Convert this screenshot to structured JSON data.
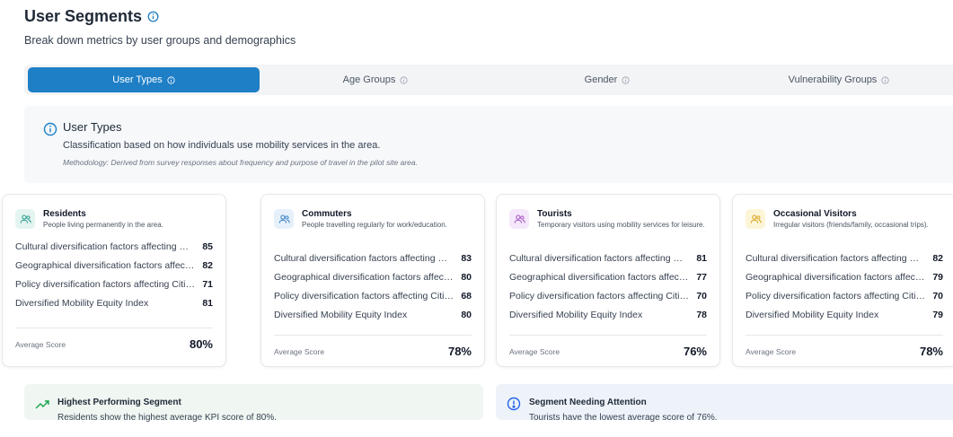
{
  "page": {
    "title": "User Segments",
    "subtitle": "Break down metrics by user groups and demographics"
  },
  "tabs": [
    {
      "label": "User Types",
      "active": true
    },
    {
      "label": "Age Groups",
      "active": false
    },
    {
      "label": "Gender",
      "active": false
    },
    {
      "label": "Vulnerability Groups",
      "active": false
    }
  ],
  "info": {
    "title": "User Types",
    "description": "Classification based on how individuals use mobility services in the area.",
    "methodology": "Methodology: Derived from survey responses about frequency and purpose of travel in the pilot site area."
  },
  "segments": [
    {
      "name": "Residents",
      "description": "People living permanently in the area.",
      "icon": "users-icon",
      "icon_color": "#2e9e8f",
      "icon_bg": "#e3f4f1",
      "metrics": [
        {
          "label": "Cultural diversification factors affecting mobility equity",
          "value": "85"
        },
        {
          "label": "Geographical diversification factors affecting mobility equity",
          "value": "82"
        },
        {
          "label": "Policy diversification factors affecting Cities mobility equity",
          "value": "71"
        },
        {
          "label": "Diversified Mobility Equity Index",
          "value": "81"
        }
      ],
      "average_label": "Average Score",
      "average": "80%"
    },
    {
      "name": "Commuters",
      "description": "People travelling regularly for work/education.",
      "icon": "users-icon",
      "icon_color": "#3b82c4",
      "icon_bg": "#e6f0fa",
      "metrics": [
        {
          "label": "Cultural diversification factors affecting mobility equity",
          "value": "83"
        },
        {
          "label": "Geographical diversification factors affecting mobility equity",
          "value": "80"
        },
        {
          "label": "Policy diversification factors affecting Cities mobility equity",
          "value": "68"
        },
        {
          "label": "Diversified Mobility Equity Index",
          "value": "80"
        }
      ],
      "average_label": "Average Score",
      "average": "78%"
    },
    {
      "name": "Tourists",
      "description": "Temporary visitors using mobility services for leisure.",
      "icon": "users-icon",
      "icon_color": "#a855c7",
      "icon_bg": "#f4e8fa",
      "metrics": [
        {
          "label": "Cultural diversification factors affecting mobility equity",
          "value": "81"
        },
        {
          "label": "Geographical diversification factors affecting mobility equity",
          "value": "77"
        },
        {
          "label": "Policy diversification factors affecting Cities mobility equity",
          "value": "70"
        },
        {
          "label": "Diversified Mobility Equity Index",
          "value": "78"
        }
      ],
      "average_label": "Average Score",
      "average": "76%"
    },
    {
      "name": "Occasional Visitors",
      "description": "Irregular visitors (friends/family, occasional trips).",
      "icon": "users-icon",
      "icon_color": "#d9a520",
      "icon_bg": "#fdf5d8",
      "metrics": [
        {
          "label": "Cultural diversification factors affecting mobility equity",
          "value": "82"
        },
        {
          "label": "Geographical diversification factors affecting mobility equity",
          "value": "79"
        },
        {
          "label": "Policy diversification factors affecting Cities mobility equity",
          "value": "70"
        },
        {
          "label": "Diversified Mobility Equity Index",
          "value": "79"
        }
      ],
      "average_label": "Average Score",
      "average": "78%"
    }
  ],
  "insights": {
    "highest": {
      "title": "Highest Performing Segment",
      "text": "Residents show the highest average KPI score of 80%.",
      "icon": "trending-up-icon",
      "color": "#16a34a"
    },
    "attention": {
      "title": "Segment Needing Attention",
      "text": "Tourists have the lowest average score of 76%.",
      "icon": "alert-circle-icon",
      "color": "#2563eb"
    }
  },
  "colors": {
    "accent": "#1e7fc6"
  }
}
